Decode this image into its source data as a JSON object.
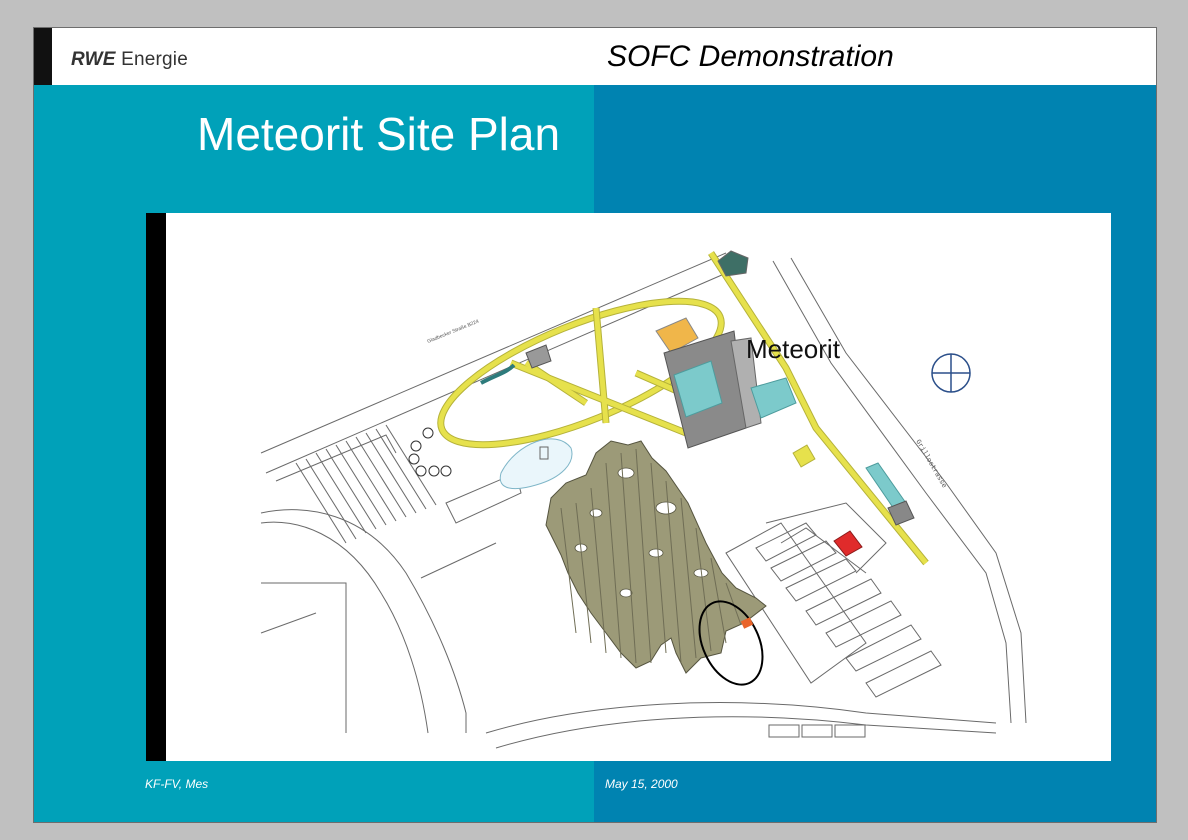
{
  "header": {
    "logo_bold": "RWE",
    "logo_text": "Energie",
    "title": "SOFC Demonstration"
  },
  "slide": {
    "title": "Meteorit Site Plan"
  },
  "map": {
    "building_label": "Meteorit",
    "street_label_1": "Gladbecker Straße B224",
    "street_label_2": "Grillostrasse"
  },
  "footer": {
    "left": "KF-FV, Mes",
    "right": "May 15, 2000"
  },
  "colors": {
    "panel_left": "#00a1b9",
    "panel_right": "#0083b1",
    "road_yellow": "#e6e14c",
    "vegetation": "#9c9a78",
    "building_gray": "#8a8a8a",
    "teal_roof": "#7ccacb",
    "red_marker": "#e02b2b"
  }
}
